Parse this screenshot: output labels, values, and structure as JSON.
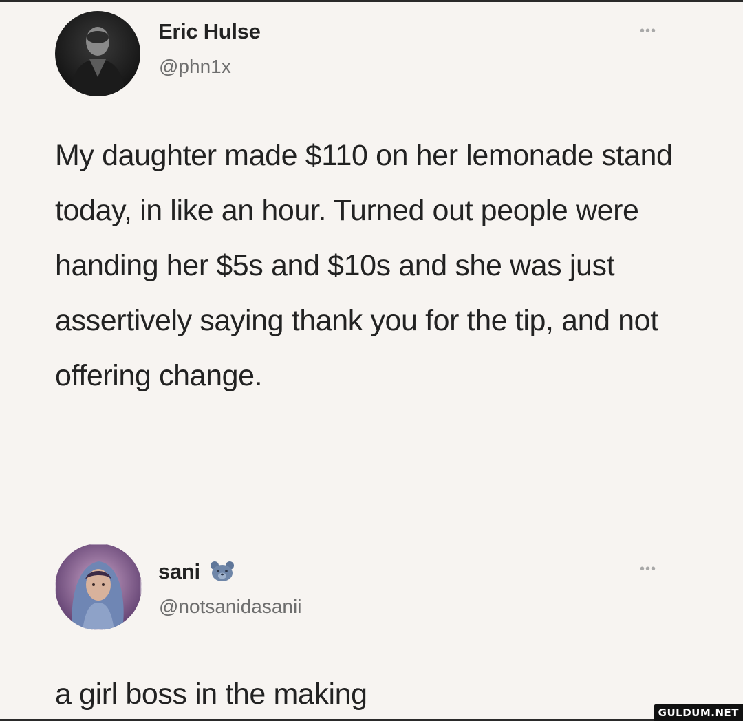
{
  "tweets": [
    {
      "name": "Eric Hulse",
      "handle": "@phn1x",
      "more": "•••",
      "text": "My daughter made $110 on her lemonade stand today, in like an hour. Turned out people were handing her $5s and $10s and she was just assertively saying thank you for the tip, and not offering change."
    },
    {
      "name": "sani",
      "name_emoji": "bear-face-emoji",
      "handle": "@notsanidasanii",
      "more": "•••",
      "text": "a girl boss in the making"
    }
  ],
  "watermark": "GULDUM.NET",
  "colors": {
    "background": "#f7f4f1",
    "text": "#222222",
    "handle": "#6e6e6e",
    "emoji": "#6f86a8"
  }
}
